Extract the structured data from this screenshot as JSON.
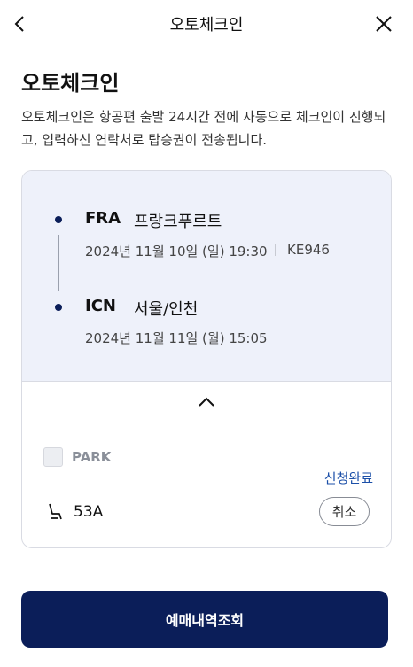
{
  "header": {
    "title": "오토체크인",
    "back_icon": "chevron-left-icon",
    "close_icon": "close-icon"
  },
  "main": {
    "heading": "오토체크인",
    "description": "오토체크인은 항공편 출발 24시간 전에 자동으로 체크인이 진행되고, 입력하신 연락처로 탑승권이 전송됩니다."
  },
  "flight": {
    "departure": {
      "code": "FRA",
      "city": "프랑크푸르트",
      "datetime": "2024년 11월 10일 (일) 19:30",
      "flight_no": "KE946"
    },
    "arrival": {
      "code": "ICN",
      "city": "서울/인천",
      "datetime": "2024년 11월 11일 (월) 15:05"
    },
    "collapse_icon": "chevron-up-icon"
  },
  "passenger": {
    "name": "PARK",
    "status": "신청완료",
    "seat": "53A",
    "seat_icon": "seat-icon",
    "cancel_label": "취소",
    "checked": false
  },
  "footer": {
    "primary_label": "예매내역조회"
  },
  "colors": {
    "brand_navy": "#0b1e59",
    "status_blue": "#1b4fa8",
    "card_bg": "#eef1fa"
  }
}
